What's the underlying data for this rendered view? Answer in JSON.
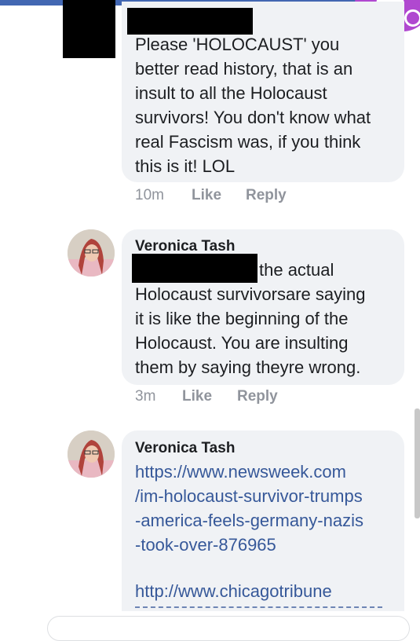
{
  "comments": [
    {
      "text": "Please 'HOLOCAUST' you\nbetter read history, that is an\ninsult to all the Holocaust\nsurvivors! You don't know what\nreal Fascism was, if you think\nthis is it! LOL",
      "time": "10m",
      "like_label": "Like",
      "reply_label": "Reply"
    },
    {
      "author": "Veronica Tash",
      "text": "the actual\nHolocaust survivorsare saying\nit is like the beginning of the\nHolocaust.  You are insulting\nthem by saying theyre wrong.",
      "time": "3m",
      "like_label": "Like",
      "reply_label": "Reply"
    },
    {
      "author": "Veronica Tash",
      "link1": "https://www.newsweek.com\n/im-holocaust-survivor-trumps\n-america-feels-germany-nazis\n-took-over-876965",
      "link2": "http://www.chicagotribune"
    }
  ],
  "icons": {
    "avatar": "profile-photo",
    "fab": "chat-head-icon"
  },
  "colors": {
    "link": "#365899",
    "bubble": "#f0f2f5",
    "meta": "#90949c",
    "accent": "#b048d0"
  }
}
